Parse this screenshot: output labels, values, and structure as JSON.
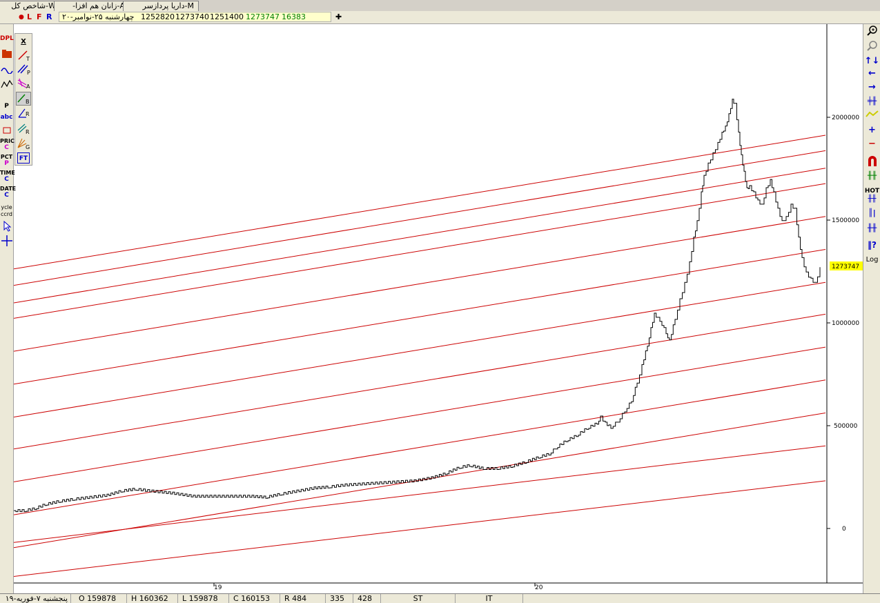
{
  "tabs": [
    "شاخص كل-W",
    "-زانان هم افزا-A",
    "داریا پردازسر-M"
  ],
  "infobar": {
    "modes": [
      "L",
      "F",
      "R"
    ],
    "date": "چهارشنبه ۲۵-نوامبر-۲۰",
    "open": "1252820",
    "high": "1273740",
    "low": "1251400",
    "close": "1273747",
    "change": "16383",
    "crosshair": "✚"
  },
  "left_toolbar": [
    "DPL",
    "P",
    "abc",
    "PRICE",
    "C",
    "PCT",
    "P",
    "TIME",
    "C",
    "DATE",
    "C",
    "ycle",
    "ccrd"
  ],
  "tool_panel": [
    "X",
    "T",
    "P",
    "A",
    "B",
    "R",
    "R",
    "G",
    "FT"
  ],
  "right_toolbar": {
    "hot": "HOT",
    "log": "Log"
  },
  "status": {
    "date": "پنجشنبه ۷-فوریه-۱۹",
    "open": "O 159878",
    "high": "H 160362",
    "low": "L 159878",
    "close": "C 160153",
    "r": "R 484",
    "v1": "335",
    "v2": "428",
    "st": "ST",
    "it": "IT"
  },
  "colors": {
    "channel": "#cc0000",
    "price_line": "#000000",
    "last_price_tag": "#ffff00",
    "background": "#ffffff"
  },
  "chart_data": {
    "type": "line",
    "x_tick_labels": [
      "19",
      "20"
    ],
    "y_tick_labels": [
      "2000000",
      "1500000",
      "1000000",
      "500000",
      "0"
    ],
    "ylim": [
      -240000,
      2460000
    ],
    "last_value": "1273747",
    "price_series": [
      {
        "x": 0,
        "y": 95000
      },
      {
        "x": 15,
        "y": 95000
      },
      {
        "x": 30,
        "y": 105000
      },
      {
        "x": 45,
        "y": 125000
      },
      {
        "x": 65,
        "y": 140000
      },
      {
        "x": 85,
        "y": 150000
      },
      {
        "x": 110,
        "y": 160000
      },
      {
        "x": 135,
        "y": 170000
      },
      {
        "x": 155,
        "y": 190000
      },
      {
        "x": 175,
        "y": 200000
      },
      {
        "x": 200,
        "y": 190000
      },
      {
        "x": 230,
        "y": 180000
      },
      {
        "x": 260,
        "y": 165000
      },
      {
        "x": 290,
        "y": 165000
      },
      {
        "x": 320,
        "y": 165000
      },
      {
        "x": 345,
        "y": 165000
      },
      {
        "x": 365,
        "y": 160000
      },
      {
        "x": 385,
        "y": 175000
      },
      {
        "x": 410,
        "y": 190000
      },
      {
        "x": 435,
        "y": 205000
      },
      {
        "x": 455,
        "y": 210000
      },
      {
        "x": 480,
        "y": 220000
      },
      {
        "x": 505,
        "y": 225000
      },
      {
        "x": 530,
        "y": 230000
      },
      {
        "x": 555,
        "y": 235000
      },
      {
        "x": 580,
        "y": 240000
      },
      {
        "x": 605,
        "y": 255000
      },
      {
        "x": 625,
        "y": 275000
      },
      {
        "x": 645,
        "y": 305000
      },
      {
        "x": 660,
        "y": 315000
      },
      {
        "x": 680,
        "y": 300000
      },
      {
        "x": 700,
        "y": 300000
      },
      {
        "x": 720,
        "y": 310000
      },
      {
        "x": 740,
        "y": 330000
      },
      {
        "x": 760,
        "y": 355000
      },
      {
        "x": 775,
        "y": 370000
      },
      {
        "x": 785,
        "y": 400000
      },
      {
        "x": 800,
        "y": 435000
      },
      {
        "x": 815,
        "y": 460000
      },
      {
        "x": 830,
        "y": 495000
      },
      {
        "x": 845,
        "y": 520000
      },
      {
        "x": 850,
        "y": 550000
      },
      {
        "x": 857,
        "y": 520000
      },
      {
        "x": 865,
        "y": 500000
      },
      {
        "x": 875,
        "y": 530000
      },
      {
        "x": 885,
        "y": 580000
      },
      {
        "x": 895,
        "y": 630000
      },
      {
        "x": 903,
        "y": 720000
      },
      {
        "x": 910,
        "y": 800000
      },
      {
        "x": 918,
        "y": 900000
      },
      {
        "x": 923,
        "y": 980000
      },
      {
        "x": 928,
        "y": 1050000
      },
      {
        "x": 936,
        "y": 1020000
      },
      {
        "x": 945,
        "y": 960000
      },
      {
        "x": 950,
        "y": 920000
      },
      {
        "x": 958,
        "y": 1030000
      },
      {
        "x": 965,
        "y": 1120000
      },
      {
        "x": 972,
        "y": 1200000
      },
      {
        "x": 979,
        "y": 1300000
      },
      {
        "x": 985,
        "y": 1420000
      },
      {
        "x": 990,
        "y": 1500000
      },
      {
        "x": 996,
        "y": 1640000
      },
      {
        "x": 1000,
        "y": 1720000
      },
      {
        "x": 1006,
        "y": 1780000
      },
      {
        "x": 1013,
        "y": 1830000
      },
      {
        "x": 1020,
        "y": 1880000
      },
      {
        "x": 1026,
        "y": 1930000
      },
      {
        "x": 1031,
        "y": 1960000
      },
      {
        "x": 1036,
        "y": 2020000
      },
      {
        "x": 1041,
        "y": 2090000
      },
      {
        "x": 1045,
        "y": 2070000
      },
      {
        "x": 1050,
        "y": 1930000
      },
      {
        "x": 1054,
        "y": 1820000
      },
      {
        "x": 1058,
        "y": 1740000
      },
      {
        "x": 1062,
        "y": 1660000
      },
      {
        "x": 1066,
        "y": 1670000
      },
      {
        "x": 1072,
        "y": 1640000
      },
      {
        "x": 1078,
        "y": 1600000
      },
      {
        "x": 1084,
        "y": 1580000
      },
      {
        "x": 1090,
        "y": 1660000
      },
      {
        "x": 1096,
        "y": 1700000
      },
      {
        "x": 1101,
        "y": 1640000
      },
      {
        "x": 1107,
        "y": 1560000
      },
      {
        "x": 1113,
        "y": 1500000
      },
      {
        "x": 1119,
        "y": 1520000
      },
      {
        "x": 1126,
        "y": 1580000
      },
      {
        "x": 1132,
        "y": 1560000
      },
      {
        "x": 1137,
        "y": 1420000
      },
      {
        "x": 1142,
        "y": 1320000
      },
      {
        "x": 1148,
        "y": 1250000
      },
      {
        "x": 1155,
        "y": 1220000
      },
      {
        "x": 1161,
        "y": 1200000
      },
      {
        "x": 1168,
        "y": 1273747
      }
    ],
    "channel_lines": [
      {
        "y_start": 1270000,
        "y_end": 1920000
      },
      {
        "y_start": 1190000,
        "y_end": 1845000
      },
      {
        "y_start": 1105000,
        "y_end": 1760000
      },
      {
        "y_start": 1030000,
        "y_end": 1685000
      },
      {
        "y_start": 870000,
        "y_end": 1525000
      },
      {
        "y_start": 710000,
        "y_end": 1365000
      },
      {
        "y_start": 550000,
        "y_end": 1205000
      },
      {
        "y_start": 395000,
        "y_end": 1050000
      },
      {
        "y_start": 235000,
        "y_end": 890000
      },
      {
        "y_start": 75000,
        "y_end": 730000
      },
      {
        "y_start": -85000,
        "y_end": 570000
      },
      {
        "y_start": -60000,
        "y_end": 410000
      },
      {
        "y_start": -225000,
        "y_end": 240000
      }
    ]
  }
}
